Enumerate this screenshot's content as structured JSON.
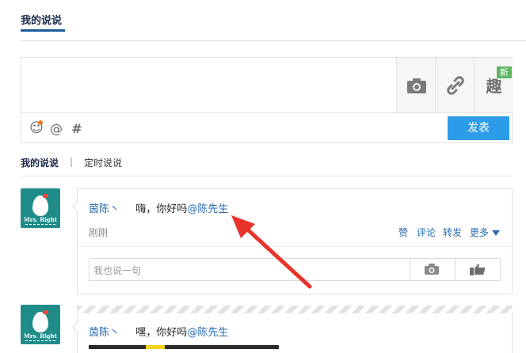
{
  "page": {
    "title": "我的说说"
  },
  "composer": {
    "side_buttons": [
      {
        "name": "camera-button",
        "icon": "camera-icon"
      },
      {
        "name": "attach-link-button",
        "icon": "link-icon"
      },
      {
        "name": "fun-button",
        "icon": "qu-icon",
        "glyph": "趣",
        "badge": "新"
      }
    ],
    "tools": [
      {
        "name": "emoji-icon",
        "glyph": "☺"
      },
      {
        "name": "at-icon",
        "glyph": "@"
      },
      {
        "name": "hashtag-icon",
        "glyph": "#"
      }
    ],
    "publish_label": "发表",
    "accent_color": "#2c9be8"
  },
  "tabs": {
    "active": "我的说说",
    "separator": "|",
    "second": "定时说说"
  },
  "posts": [
    {
      "author": "茵陈丶",
      "text": "嗨，你好吗",
      "mention": "@陈先生",
      "time": "刚刚",
      "actions": [
        "赞",
        "评论",
        "转发",
        "更多"
      ],
      "comment_placeholder": "我也说一句",
      "avatar_text": "Mrs. Right"
    },
    {
      "author": "茵陈丶",
      "text": "嘿，你好吗",
      "mention": "@陈先生",
      "avatar_text": "Mrs. Right"
    }
  ]
}
